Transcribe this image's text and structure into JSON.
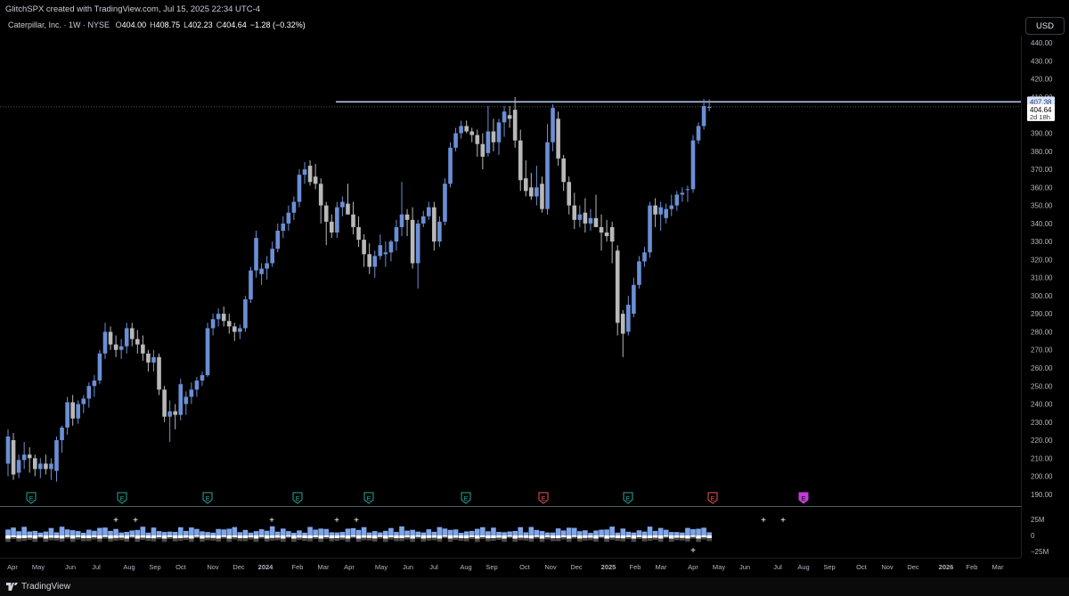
{
  "attribution": "GlitchSPX created with TradingView.com, Jul 15, 2025 22:34 UTC-4",
  "symbol": {
    "name": "Caterpillar, Inc.",
    "interval": "1W",
    "exchange": "NYSE",
    "open_label": "O",
    "open": "404.00",
    "high_label": "H",
    "high": "408.75",
    "low_label": "L",
    "low": "402.23",
    "close_label": "C",
    "close": "404.64",
    "change": "−1.28 (−0.32%)"
  },
  "currency": "USD",
  "brand": "TradingView",
  "colors": {
    "up": "#6b8fd6",
    "down": "#b8b8b8",
    "resistance": "#b0c4e8",
    "earnings": "#26a69a",
    "earnings_miss": "#ef5350",
    "earnings_upcoming": "#c23cd6"
  },
  "chart_data": {
    "type": "candlestick",
    "timeframe": "1W",
    "ylim": [
      185,
      448
    ],
    "y_ticks": [
      "440.00",
      "430.00",
      "420.00",
      "410.00",
      "390.00",
      "380.00",
      "370.00",
      "360.00",
      "350.00",
      "340.00",
      "330.00",
      "320.00",
      "310.00",
      "300.00",
      "290.00",
      "280.00",
      "270.00",
      "260.00",
      "250.00",
      "240.00",
      "230.00",
      "220.00",
      "210.00",
      "200.00",
      "190.00"
    ],
    "y_tick_values": [
      440,
      430,
      420,
      410,
      390,
      380,
      370,
      360,
      350,
      340,
      330,
      320,
      310,
      300,
      290,
      280,
      270,
      260,
      250,
      240,
      230,
      220,
      210,
      200,
      190
    ],
    "x_labels": [
      "Apr",
      "May",
      "Jun",
      "Jul",
      "Aug",
      "Sep",
      "Oct",
      "Nov",
      "Dec",
      "2024",
      "Feb",
      "Mar",
      "Apr",
      "May",
      "Jun",
      "Jul",
      "Aug",
      "Sep",
      "Oct",
      "Nov",
      "Dec",
      "2025",
      "Feb",
      "Mar",
      "Apr",
      "May",
      "Jun",
      "Jul",
      "Aug",
      "Sep",
      "Oct",
      "Nov",
      "Dec",
      "2026",
      "Feb",
      "Mar"
    ],
    "x_label_bold": [
      "2024",
      "2025",
      "2026"
    ],
    "resistance_level": 407.38,
    "last_price": 404.64,
    "price_labels": {
      "resistance": "407.38",
      "last": "404.64",
      "countdown": "2d 18h"
    },
    "earnings_markers": [
      {
        "label": "E",
        "status": "beat"
      },
      {
        "label": "E",
        "status": "beat"
      },
      {
        "label": "E",
        "status": "beat"
      },
      {
        "label": "E",
        "status": "beat"
      },
      {
        "label": "E",
        "status": "beat"
      },
      {
        "label": "E",
        "status": "beat"
      },
      {
        "label": "E",
        "status": "miss"
      },
      {
        "label": "E",
        "status": "beat"
      },
      {
        "label": "E",
        "status": "miss"
      },
      {
        "label": "E",
        "status": "upcoming"
      }
    ],
    "candles": [
      {
        "o": 207,
        "h": 226,
        "l": 200,
        "c": 222
      },
      {
        "o": 220,
        "h": 224,
        "l": 198,
        "c": 201
      },
      {
        "o": 202,
        "h": 212,
        "l": 199,
        "c": 209
      },
      {
        "o": 209,
        "h": 219,
        "l": 204,
        "c": 212
      },
      {
        "o": 212,
        "h": 216,
        "l": 202,
        "c": 210
      },
      {
        "o": 210,
        "h": 212,
        "l": 200,
        "c": 204
      },
      {
        "o": 204,
        "h": 210,
        "l": 199,
        "c": 207
      },
      {
        "o": 207,
        "h": 212,
        "l": 201,
        "c": 204
      },
      {
        "o": 204,
        "h": 210,
        "l": 198,
        "c": 207
      },
      {
        "o": 203,
        "h": 222,
        "l": 197,
        "c": 220
      },
      {
        "o": 220,
        "h": 228,
        "l": 213,
        "c": 227
      },
      {
        "o": 227,
        "h": 244,
        "l": 223,
        "c": 241
      },
      {
        "o": 241,
        "h": 245,
        "l": 228,
        "c": 232
      },
      {
        "o": 232,
        "h": 242,
        "l": 229,
        "c": 240
      },
      {
        "o": 240,
        "h": 245,
        "l": 235,
        "c": 243
      },
      {
        "o": 243,
        "h": 252,
        "l": 238,
        "c": 250
      },
      {
        "o": 250,
        "h": 256,
        "l": 244,
        "c": 253
      },
      {
        "o": 253,
        "h": 270,
        "l": 251,
        "c": 268
      },
      {
        "o": 268,
        "h": 285,
        "l": 265,
        "c": 280
      },
      {
        "o": 280,
        "h": 283,
        "l": 270,
        "c": 273
      },
      {
        "o": 273,
        "h": 278,
        "l": 266,
        "c": 270
      },
      {
        "o": 270,
        "h": 276,
        "l": 265,
        "c": 272
      },
      {
        "o": 272,
        "h": 285,
        "l": 268,
        "c": 282
      },
      {
        "o": 282,
        "h": 285,
        "l": 272,
        "c": 276
      },
      {
        "o": 276,
        "h": 281,
        "l": 268,
        "c": 273
      },
      {
        "o": 273,
        "h": 278,
        "l": 264,
        "c": 268
      },
      {
        "o": 268,
        "h": 270,
        "l": 258,
        "c": 263
      },
      {
        "o": 263,
        "h": 270,
        "l": 258,
        "c": 266
      },
      {
        "o": 266,
        "h": 268,
        "l": 245,
        "c": 248
      },
      {
        "o": 248,
        "h": 250,
        "l": 230,
        "c": 233
      },
      {
        "o": 233,
        "h": 242,
        "l": 219,
        "c": 236
      },
      {
        "o": 236,
        "h": 240,
        "l": 226,
        "c": 234
      },
      {
        "o": 234,
        "h": 254,
        "l": 231,
        "c": 251
      },
      {
        "o": 240,
        "h": 247,
        "l": 234,
        "c": 244
      },
      {
        "o": 244,
        "h": 252,
        "l": 240,
        "c": 248
      },
      {
        "o": 248,
        "h": 255,
        "l": 244,
        "c": 253
      },
      {
        "o": 253,
        "h": 258,
        "l": 250,
        "c": 256
      },
      {
        "o": 256,
        "h": 285,
        "l": 255,
        "c": 282
      },
      {
        "o": 282,
        "h": 290,
        "l": 278,
        "c": 287
      },
      {
        "o": 287,
        "h": 293,
        "l": 283,
        "c": 290
      },
      {
        "o": 290,
        "h": 294,
        "l": 283,
        "c": 286
      },
      {
        "o": 286,
        "h": 290,
        "l": 279,
        "c": 283
      },
      {
        "o": 283,
        "h": 285,
        "l": 275,
        "c": 280
      },
      {
        "o": 280,
        "h": 284,
        "l": 276,
        "c": 282
      },
      {
        "o": 282,
        "h": 300,
        "l": 280,
        "c": 298
      },
      {
        "o": 298,
        "h": 316,
        "l": 296,
        "c": 314
      },
      {
        "o": 314,
        "h": 336,
        "l": 310,
        "c": 332
      },
      {
        "o": 312,
        "h": 318,
        "l": 306,
        "c": 315
      },
      {
        "o": 315,
        "h": 322,
        "l": 309,
        "c": 318
      },
      {
        "o": 318,
        "h": 330,
        "l": 316,
        "c": 326
      },
      {
        "o": 326,
        "h": 340,
        "l": 324,
        "c": 336
      },
      {
        "o": 336,
        "h": 344,
        "l": 332,
        "c": 340
      },
      {
        "o": 340,
        "h": 350,
        "l": 336,
        "c": 346
      },
      {
        "o": 346,
        "h": 355,
        "l": 342,
        "c": 352
      },
      {
        "o": 352,
        "h": 370,
        "l": 349,
        "c": 367
      },
      {
        "o": 367,
        "h": 374,
        "l": 362,
        "c": 370
      },
      {
        "o": 372,
        "h": 375,
        "l": 361,
        "c": 363
      },
      {
        "o": 366,
        "h": 373,
        "l": 359,
        "c": 362
      },
      {
        "o": 362,
        "h": 365,
        "l": 340,
        "c": 350
      },
      {
        "o": 350,
        "h": 352,
        "l": 328,
        "c": 341
      },
      {
        "o": 341,
        "h": 345,
        "l": 332,
        "c": 335
      },
      {
        "o": 335,
        "h": 352,
        "l": 332,
        "c": 349
      },
      {
        "o": 349,
        "h": 355,
        "l": 344,
        "c": 352
      },
      {
        "o": 351,
        "h": 362,
        "l": 345,
        "c": 345
      },
      {
        "o": 345,
        "h": 352,
        "l": 334,
        "c": 338
      },
      {
        "o": 338,
        "h": 344,
        "l": 327,
        "c": 331
      },
      {
        "o": 331,
        "h": 334,
        "l": 316,
        "c": 323
      },
      {
        "o": 323,
        "h": 329,
        "l": 312,
        "c": 316
      },
      {
        "o": 316,
        "h": 325,
        "l": 310,
        "c": 322
      },
      {
        "o": 322,
        "h": 334,
        "l": 320,
        "c": 328
      },
      {
        "o": 323,
        "h": 330,
        "l": 316,
        "c": 324
      },
      {
        "o": 324,
        "h": 331,
        "l": 319,
        "c": 330
      },
      {
        "o": 330,
        "h": 342,
        "l": 325,
        "c": 338
      },
      {
        "o": 338,
        "h": 363,
        "l": 333,
        "c": 345
      },
      {
        "o": 345,
        "h": 348,
        "l": 333,
        "c": 342
      },
      {
        "o": 342,
        "h": 349,
        "l": 315,
        "c": 318
      },
      {
        "o": 318,
        "h": 342,
        "l": 304,
        "c": 340
      },
      {
        "o": 340,
        "h": 347,
        "l": 338,
        "c": 344
      },
      {
        "o": 344,
        "h": 352,
        "l": 342,
        "c": 349
      },
      {
        "o": 349,
        "h": 352,
        "l": 325,
        "c": 330
      },
      {
        "o": 330,
        "h": 344,
        "l": 327,
        "c": 341
      },
      {
        "o": 341,
        "h": 365,
        "l": 339,
        "c": 362
      },
      {
        "o": 362,
        "h": 385,
        "l": 360,
        "c": 382
      },
      {
        "o": 382,
        "h": 393,
        "l": 380,
        "c": 390
      },
      {
        "o": 390,
        "h": 397,
        "l": 387,
        "c": 394
      },
      {
        "o": 394,
        "h": 397,
        "l": 390,
        "c": 391
      },
      {
        "o": 391,
        "h": 393,
        "l": 385,
        "c": 389
      },
      {
        "o": 389,
        "h": 392,
        "l": 377,
        "c": 384
      },
      {
        "o": 384,
        "h": 390,
        "l": 370,
        "c": 377
      },
      {
        "o": 379,
        "h": 405,
        "l": 377,
        "c": 391
      },
      {
        "o": 391,
        "h": 398,
        "l": 380,
        "c": 385
      },
      {
        "o": 385,
        "h": 398,
        "l": 378,
        "c": 396
      },
      {
        "o": 396,
        "h": 405,
        "l": 388,
        "c": 402
      },
      {
        "o": 400,
        "h": 405,
        "l": 393,
        "c": 398
      },
      {
        "o": 403,
        "h": 410,
        "l": 382,
        "c": 386
      },
      {
        "o": 386,
        "h": 392,
        "l": 358,
        "c": 364
      },
      {
        "o": 365,
        "h": 375,
        "l": 355,
        "c": 358
      },
      {
        "o": 360,
        "h": 368,
        "l": 353,
        "c": 355
      },
      {
        "o": 355,
        "h": 372,
        "l": 350,
        "c": 360
      },
      {
        "o": 362,
        "h": 366,
        "l": 346,
        "c": 348
      },
      {
        "o": 348,
        "h": 395,
        "l": 345,
        "c": 385
      },
      {
        "o": 385,
        "h": 406,
        "l": 380,
        "c": 404
      },
      {
        "o": 398,
        "h": 402,
        "l": 372,
        "c": 376
      },
      {
        "o": 376,
        "h": 378,
        "l": 358,
        "c": 363
      },
      {
        "o": 363,
        "h": 366,
        "l": 345,
        "c": 350
      },
      {
        "o": 350,
        "h": 357,
        "l": 337,
        "c": 342
      },
      {
        "o": 342,
        "h": 350,
        "l": 338,
        "c": 345
      },
      {
        "o": 346,
        "h": 354,
        "l": 335,
        "c": 340
      },
      {
        "o": 340,
        "h": 348,
        "l": 336,
        "c": 343
      },
      {
        "o": 343,
        "h": 356,
        "l": 338,
        "c": 338
      },
      {
        "o": 338,
        "h": 345,
        "l": 325,
        "c": 335
      },
      {
        "o": 335,
        "h": 342,
        "l": 330,
        "c": 333
      },
      {
        "o": 338,
        "h": 341,
        "l": 318,
        "c": 330
      },
      {
        "o": 325,
        "h": 328,
        "l": 278,
        "c": 285
      },
      {
        "o": 290,
        "h": 292,
        "l": 266,
        "c": 279
      },
      {
        "o": 280,
        "h": 300,
        "l": 278,
        "c": 295
      },
      {
        "o": 290,
        "h": 310,
        "l": 288,
        "c": 306
      },
      {
        "o": 306,
        "h": 322,
        "l": 304,
        "c": 319
      },
      {
        "o": 319,
        "h": 327,
        "l": 316,
        "c": 324
      },
      {
        "o": 324,
        "h": 352,
        "l": 321,
        "c": 350
      },
      {
        "o": 350,
        "h": 354,
        "l": 338,
        "c": 345
      },
      {
        "o": 345,
        "h": 352,
        "l": 336,
        "c": 349
      },
      {
        "o": 343,
        "h": 351,
        "l": 340,
        "c": 348
      },
      {
        "o": 348,
        "h": 356,
        "l": 344,
        "c": 350
      },
      {
        "o": 350,
        "h": 358,
        "l": 347,
        "c": 356
      },
      {
        "o": 356,
        "h": 360,
        "l": 352,
        "c": 357
      },
      {
        "o": 359,
        "h": 361,
        "l": 352,
        "c": 359
      },
      {
        "o": 359,
        "h": 389,
        "l": 357,
        "c": 386
      },
      {
        "o": 386,
        "h": 396,
        "l": 384,
        "c": 394
      },
      {
        "o": 394,
        "h": 409,
        "l": 392,
        "c": 405
      },
      {
        "o": 404,
        "h": 408.75,
        "l": 402.23,
        "c": 404.64
      }
    ],
    "volume_axis": [
      "25M",
      "0",
      "−25M"
    ],
    "volume_ylim": [
      -30,
      30
    ]
  }
}
